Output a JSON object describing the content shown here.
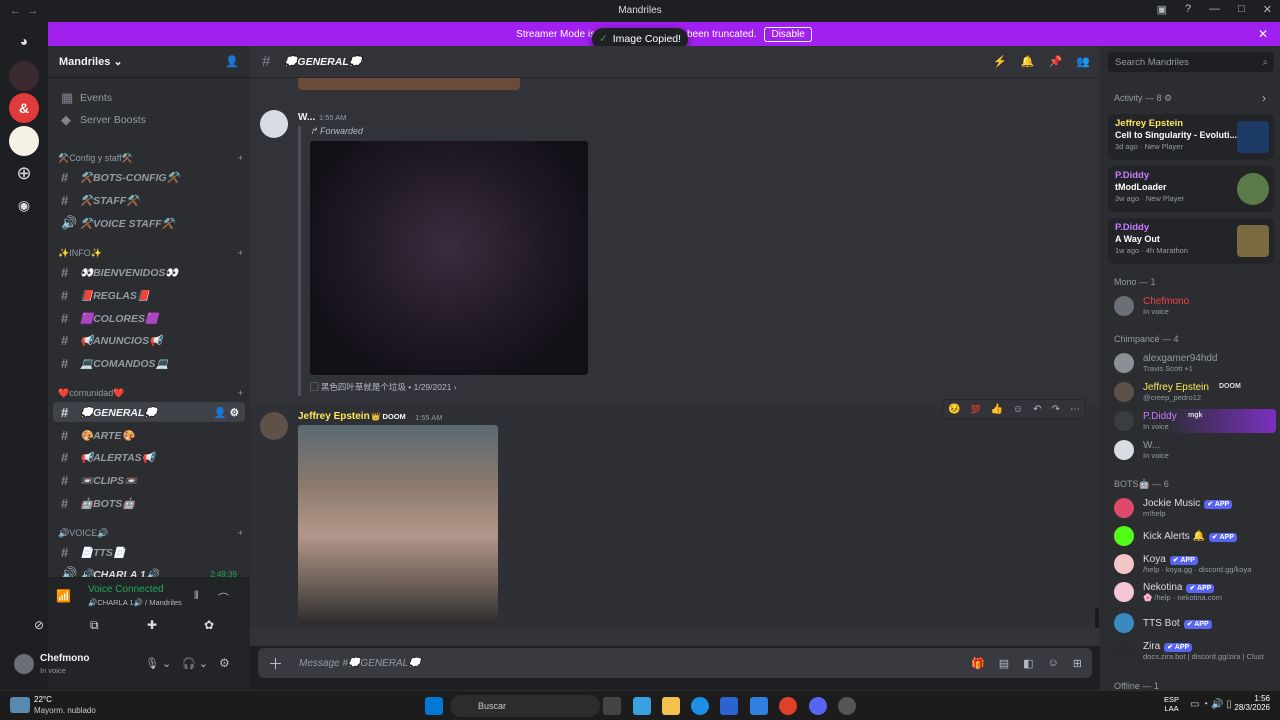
{
  "window": {
    "title": "Mandriles"
  },
  "banner": {
    "text_left": "Streamer Mode is en",
    "text_right": "been truncated.",
    "disable_label": "Disable"
  },
  "toast": {
    "label": "Image Copied!"
  },
  "guild": {
    "name": "Mandriles"
  },
  "sidebar": {
    "top_items": [
      {
        "label": "Events"
      },
      {
        "label": "Server Boosts"
      }
    ],
    "categories": [
      {
        "label": "⚒️Config y staff⚒️"
      },
      {
        "label": "✨INFO✨"
      },
      {
        "label": "❤️comunidad❤️"
      },
      {
        "label": "🔊VOICE🔊"
      }
    ],
    "channels": [
      {
        "label": "⚒️BOTS-CONFIG⚒️",
        "icon": "#"
      },
      {
        "label": "⚒️STAFF⚒️",
        "icon": "#"
      },
      {
        "label": "⚒️VOICE STAFF⚒️",
        "icon": "🔊"
      },
      {
        "label": "👀BIENVENIDOS👀",
        "icon": "#"
      },
      {
        "label": "📕REGLAS📕",
        "icon": "#"
      },
      {
        "label": "🟪COLORES🟪",
        "icon": "#"
      },
      {
        "label": "📢ANUNCIOS📢",
        "icon": "#"
      },
      {
        "label": "💻COMANDOS💻",
        "icon": "#"
      },
      {
        "label": "💭GENERAL💭",
        "icon": "#"
      },
      {
        "label": "🎨ARTE🎨",
        "icon": "#"
      },
      {
        "label": "📢ALERTAS📢",
        "icon": "#"
      },
      {
        "label": "📼CLIPS📼",
        "icon": "#"
      },
      {
        "label": "🤖BOTS🤖",
        "icon": "#"
      },
      {
        "label": "📄TTS📄",
        "icon": "#"
      },
      {
        "label": "🔊CHARLA 1🔊",
        "icon": "🔊",
        "time": "2:49:39"
      }
    ]
  },
  "voice": {
    "status": "Voice Connected",
    "channel": "🔊CHARLA 1🔊 / Mandriles"
  },
  "user": {
    "name": "Chefmono",
    "status": "In voice"
  },
  "chat": {
    "channel_name": "💭GENERAL💭",
    "placeholder": "Message #💭GENERAL💭",
    "msg1": {
      "author": "W...",
      "time": "1:55 AM",
      "forwarded": "Forwarded",
      "source": "黑色四叶草就是个垃圾",
      "date": "1/29/2021"
    },
    "msg2": {
      "author": "Jeffrey Epstein",
      "tag": "DOOM",
      "time": "1:55 AM"
    }
  },
  "members": {
    "search_placeholder": "Search Mandriles",
    "activity_header": "Activity — 8",
    "activities": [
      {
        "name": "Jeffrey Epstein",
        "game": "Cell to Singularity - Evoluti...",
        "meta": "3d ago · New Player"
      },
      {
        "name": "P.Diddy",
        "game": "tModLoader",
        "meta": "3w ago · New Player"
      },
      {
        "name": "P.Diddy",
        "game": "A Way Out",
        "meta": "1w ago · 4h Marathon"
      }
    ],
    "sections": [
      {
        "label": "Mono — 1"
      },
      {
        "label": "Chimpancé — 4"
      },
      {
        "label": "BOTS🤖 — 6"
      },
      {
        "label": "Offline — 1"
      }
    ],
    "list": [
      {
        "name": "Chefmono",
        "status": "In voice",
        "color": "#f23f43"
      },
      {
        "name": "alexgamer94hdd",
        "status": "Travis Scott +1",
        "color": "#949ba4"
      },
      {
        "name": "Jeffrey Epstein",
        "status": "@creep_pedro12",
        "color": "#fee75c",
        "tag": "DOOM"
      },
      {
        "name": "P.Diddy",
        "status": "In voice",
        "color": "#c77dff",
        "tag": "mgk"
      },
      {
        "name": "W...",
        "status": "In voice",
        "color": "#949ba4"
      },
      {
        "name": "Jockie Music",
        "status": "m!help",
        "color": "#dbdee1"
      },
      {
        "name": "Kick Alerts 🔔",
        "status": "",
        "color": "#dbdee1"
      },
      {
        "name": "Koya",
        "status": "/help · koya.gg · discord.gg/koya",
        "color": "#dbdee1"
      },
      {
        "name": "Nekotina",
        "status": "🌸 /help · nekotina.com",
        "color": "#dbdee1"
      },
      {
        "name": "TTS Bot",
        "status": "",
        "color": "#dbdee1"
      },
      {
        "name": "Zira",
        "status": "docs.zira.bot | discord.gg/zira | Clust",
        "color": "#dbdee1"
      }
    ],
    "app_label": "✔ APP"
  },
  "taskbar": {
    "weather_temp": "22°C",
    "weather_desc": "Mayorm. nublado",
    "search": "Buscar",
    "lang1": "ESP",
    "lang2": "LAA",
    "time": "1:56",
    "date": "28/3/2026"
  }
}
